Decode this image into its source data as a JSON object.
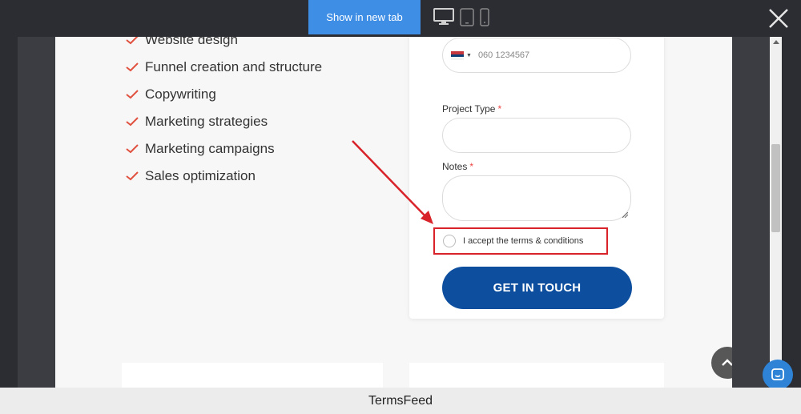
{
  "toolbar": {
    "show_tab_label": "Show in new tab",
    "devices": [
      "desktop-icon",
      "tablet-icon",
      "mobile-icon"
    ],
    "close_icon": "close-icon"
  },
  "features": [
    "Website design",
    "Funnel creation and structure",
    "Copywriting",
    "Marketing strategies",
    "Marketing campaigns",
    "Sales optimization"
  ],
  "form": {
    "phone_placeholder": "060 1234567",
    "project_type_label": "Project Type",
    "notes_label": "Notes",
    "required_mark": "*",
    "terms_label": "I accept the terms & conditions",
    "submit_label": "GET IN TOUCH"
  },
  "colors": {
    "accent_blue": "#3f8ee6",
    "button_blue": "#0d4f9e",
    "highlight_red": "#d8232a",
    "check_color": "#e0523f"
  },
  "footer": {
    "brand": "TermsFeed"
  }
}
